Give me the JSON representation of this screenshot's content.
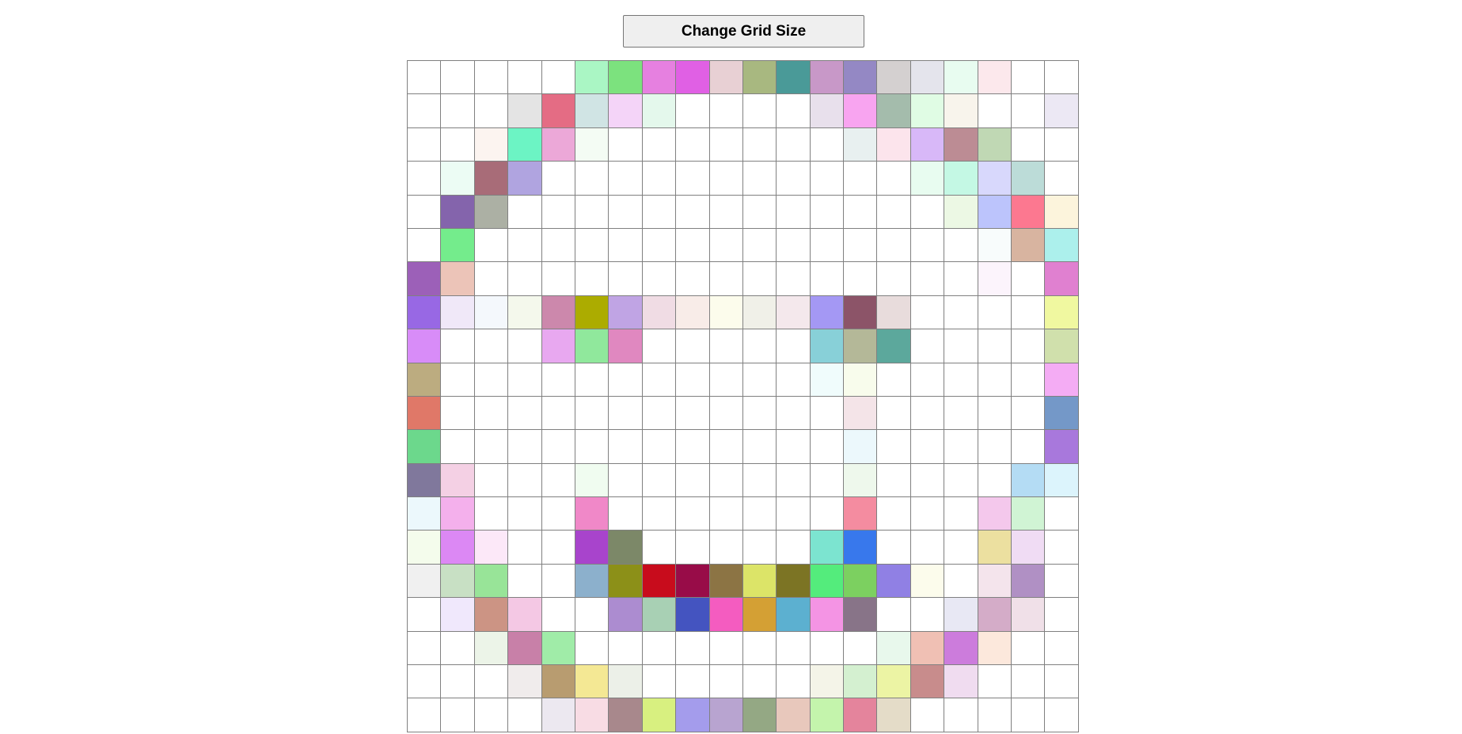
{
  "toolbar": {
    "change_grid_size_label": "Change Grid Size"
  },
  "grid": {
    "rows": 20,
    "cols": 20,
    "cells": [
      [
        "#ffffff",
        "#ffffff",
        "#ffffff",
        "#ffffff",
        "#ffffff",
        "#aaf6c4",
        "#7ce27e",
        "#e680e0",
        "#e060e4",
        "#e8d0d4",
        "#a8b880",
        "#4a9a98",
        "#c898c8",
        "#9488c4",
        "#d4d0d0",
        "#e4e4ec",
        "#e8fcf0",
        "#fce8ec",
        "#ffffff",
        "#ffffff"
      ],
      [
        "#ffffff",
        "#ffffff",
        "#ffffff",
        "#e4e4e4",
        "#e46c84",
        "#d0e4e4",
        "#f4d4f8",
        "#e4f8ec",
        "#ffffff",
        "#ffffff",
        "#ffffff",
        "#ffffff",
        "#e8e0ec",
        "#f8a4f0",
        "#a4bcac",
        "#e0fce4",
        "#f8f4ec",
        "#ffffff",
        "#ffffff",
        "#ece8f4"
      ],
      [
        "#ffffff",
        "#ffffff",
        "#fcf4f0",
        "#6cf4c4",
        "#eca8d8",
        "#f4fcf4",
        "#ffffff",
        "#ffffff",
        "#ffffff",
        "#ffffff",
        "#ffffff",
        "#ffffff",
        "#ffffff",
        "#e8f0f0",
        "#fce4ec",
        "#d8b8f8",
        "#bc8c94",
        "#c0d8b4",
        "#ffffff",
        "#ffffff"
      ],
      [
        "#ffffff",
        "#ecfcf4",
        "#a86c78",
        "#b0a4e0",
        "#ffffff",
        "#ffffff",
        "#ffffff",
        "#ffffff",
        "#ffffff",
        "#ffffff",
        "#ffffff",
        "#ffffff",
        "#ffffff",
        "#ffffff",
        "#ffffff",
        "#e8fcf0",
        "#c4f8e4",
        "#d8d8fc",
        "#bcdcd8",
        "#ffffff"
      ],
      [
        "#ffffff",
        "#8464ac",
        "#acb0a4",
        "#ffffff",
        "#ffffff",
        "#ffffff",
        "#ffffff",
        "#ffffff",
        "#ffffff",
        "#ffffff",
        "#ffffff",
        "#ffffff",
        "#ffffff",
        "#ffffff",
        "#ffffff",
        "#ffffff",
        "#ecf8e4",
        "#bcc4fc",
        "#fc7890",
        "#fcf4dc"
      ],
      [
        "#ffffff",
        "#74ec8c",
        "#ffffff",
        "#ffffff",
        "#ffffff",
        "#ffffff",
        "#ffffff",
        "#ffffff",
        "#ffffff",
        "#ffffff",
        "#ffffff",
        "#ffffff",
        "#ffffff",
        "#ffffff",
        "#ffffff",
        "#ffffff",
        "#ffffff",
        "#f8fcfc",
        "#d8b4a0",
        "#acf0ec"
      ],
      [
        "#9c60b8",
        "#ecc4b8",
        "#ffffff",
        "#ffffff",
        "#ffffff",
        "#ffffff",
        "#ffffff",
        "#ffffff",
        "#ffffff",
        "#ffffff",
        "#ffffff",
        "#ffffff",
        "#ffffff",
        "#ffffff",
        "#ffffff",
        "#ffffff",
        "#ffffff",
        "#fcf4fc",
        "#ffffff",
        "#e080d0"
      ],
      [
        "#9868e4",
        "#f0e8f8",
        "#f4f8fc",
        "#f4f8ec",
        "#cc88ac",
        "#acac00",
        "#c0a4e4",
        "#f0dce4",
        "#f8ece8",
        "#fcfcec",
        "#f0f0e8",
        "#f4e8ec",
        "#a498f4",
        "#8c5468",
        "#e8dcdc",
        "#ffffff",
        "#ffffff",
        "#ffffff",
        "#ffffff",
        "#f0f8a0"
      ],
      [
        "#d88cf8",
        "#ffffff",
        "#ffffff",
        "#ffffff",
        "#e8a8f0",
        "#90e89c",
        "#e088c0",
        "#ffffff",
        "#ffffff",
        "#ffffff",
        "#ffffff",
        "#ffffff",
        "#88d0d8",
        "#b4b898",
        "#5ca89c",
        "#ffffff",
        "#ffffff",
        "#ffffff",
        "#ffffff",
        "#d0e0ac"
      ],
      [
        "#bcac80",
        "#ffffff",
        "#ffffff",
        "#ffffff",
        "#ffffff",
        "#ffffff",
        "#ffffff",
        "#ffffff",
        "#ffffff",
        "#ffffff",
        "#ffffff",
        "#ffffff",
        "#f0fcfc",
        "#f8fcec",
        "#ffffff",
        "#ffffff",
        "#ffffff",
        "#ffffff",
        "#ffffff",
        "#f4acf4"
      ],
      [
        "#e07868",
        "#ffffff",
        "#ffffff",
        "#ffffff",
        "#ffffff",
        "#ffffff",
        "#ffffff",
        "#ffffff",
        "#ffffff",
        "#ffffff",
        "#ffffff",
        "#ffffff",
        "#ffffff",
        "#f4e4e8",
        "#ffffff",
        "#ffffff",
        "#ffffff",
        "#ffffff",
        "#ffffff",
        "#7498c8"
      ],
      [
        "#6cd88c",
        "#ffffff",
        "#ffffff",
        "#ffffff",
        "#ffffff",
        "#ffffff",
        "#ffffff",
        "#ffffff",
        "#ffffff",
        "#ffffff",
        "#ffffff",
        "#ffffff",
        "#ffffff",
        "#ecf8fc",
        "#ffffff",
        "#ffffff",
        "#ffffff",
        "#ffffff",
        "#ffffff",
        "#a878dc"
      ],
      [
        "#80789c",
        "#f4d0e4",
        "#ffffff",
        "#ffffff",
        "#ffffff",
        "#f0fcf0",
        "#ffffff",
        "#ffffff",
        "#ffffff",
        "#ffffff",
        "#ffffff",
        "#ffffff",
        "#ffffff",
        "#eef8ec",
        "#ffffff",
        "#ffffff",
        "#ffffff",
        "#ffffff",
        "#b4dcf4",
        "#dcf4fc"
      ],
      [
        "#ecf8fc",
        "#f4b0ec",
        "#ffffff",
        "#ffffff",
        "#ffffff",
        "#f088c8",
        "#ffffff",
        "#ffffff",
        "#ffffff",
        "#ffffff",
        "#ffffff",
        "#ffffff",
        "#ffffff",
        "#f48ca0",
        "#ffffff",
        "#ffffff",
        "#ffffff",
        "#f4c8ec",
        "#d0f4d4",
        "#ffffff"
      ],
      [
        "#f4fcec",
        "#dc88f4",
        "#fce8f8",
        "#ffffff",
        "#ffffff",
        "#a844cc",
        "#7c8868",
        "#ffffff",
        "#ffffff",
        "#ffffff",
        "#ffffff",
        "#ffffff",
        "#7ce4d0",
        "#3878ec",
        "#ffffff",
        "#ffffff",
        "#ffffff",
        "#ece0a0",
        "#f0dcf4",
        "#ffffff"
      ],
      [
        "#f0f0f0",
        "#c8e0c4",
        "#98e498",
        "#ffffff",
        "#ffffff",
        "#8cb0cc",
        "#8c9018",
        "#c80c1c",
        "#980c48",
        "#8c7444",
        "#dce468",
        "#7c7424",
        "#54ec7c",
        "#7cd060",
        "#9080e4",
        "#fcfcec",
        "#ffffff",
        "#f4e4ec",
        "#b090c4",
        "#ffffff"
      ],
      [
        "#ffffff",
        "#f0e8fc",
        "#cc9484",
        "#f4c8e4",
        "#ffffff",
        "#ffffff",
        "#ac8cd0",
        "#a8d0b4",
        "#4454c0",
        "#f45cc0",
        "#d4a034",
        "#5cb0d0",
        "#f494e4",
        "#887488",
        "#ffffff",
        "#ffffff",
        "#e8e8f4",
        "#d4acc8",
        "#f0e0e8",
        "#ffffff"
      ],
      [
        "#ffffff",
        "#ffffff",
        "#ecf4e8",
        "#c880a8",
        "#a0eca8",
        "#ffffff",
        "#ffffff",
        "#ffffff",
        "#ffffff",
        "#ffffff",
        "#ffffff",
        "#ffffff",
        "#ffffff",
        "#ffffff",
        "#e8f8ec",
        "#f0c0b4",
        "#cc7cdc",
        "#fce8dc",
        "#ffffff",
        "#ffffff"
      ],
      [
        "#ffffff",
        "#ffffff",
        "#ffffff",
        "#f0ecec",
        "#b89c70",
        "#f4e894",
        "#ecf0e8",
        "#ffffff",
        "#ffffff",
        "#ffffff",
        "#ffffff",
        "#ffffff",
        "#f4f4e8",
        "#d4f0d0",
        "#ecf4a4",
        "#c88c8c",
        "#f0dcf0",
        "#ffffff",
        "#ffffff",
        "#ffffff"
      ],
      [
        "#ffffff",
        "#ffffff",
        "#ffffff",
        "#ffffff",
        "#ece8f0",
        "#f8dce4",
        "#a8888c",
        "#d8f080",
        "#a49cec",
        "#b8a4d0",
        "#94a884",
        "#e8c8bc",
        "#c4f4ac",
        "#e4849c",
        "#e4dcc8",
        "#ffffff",
        "#ffffff",
        "#ffffff",
        "#ffffff",
        "#ffffff"
      ]
    ]
  }
}
